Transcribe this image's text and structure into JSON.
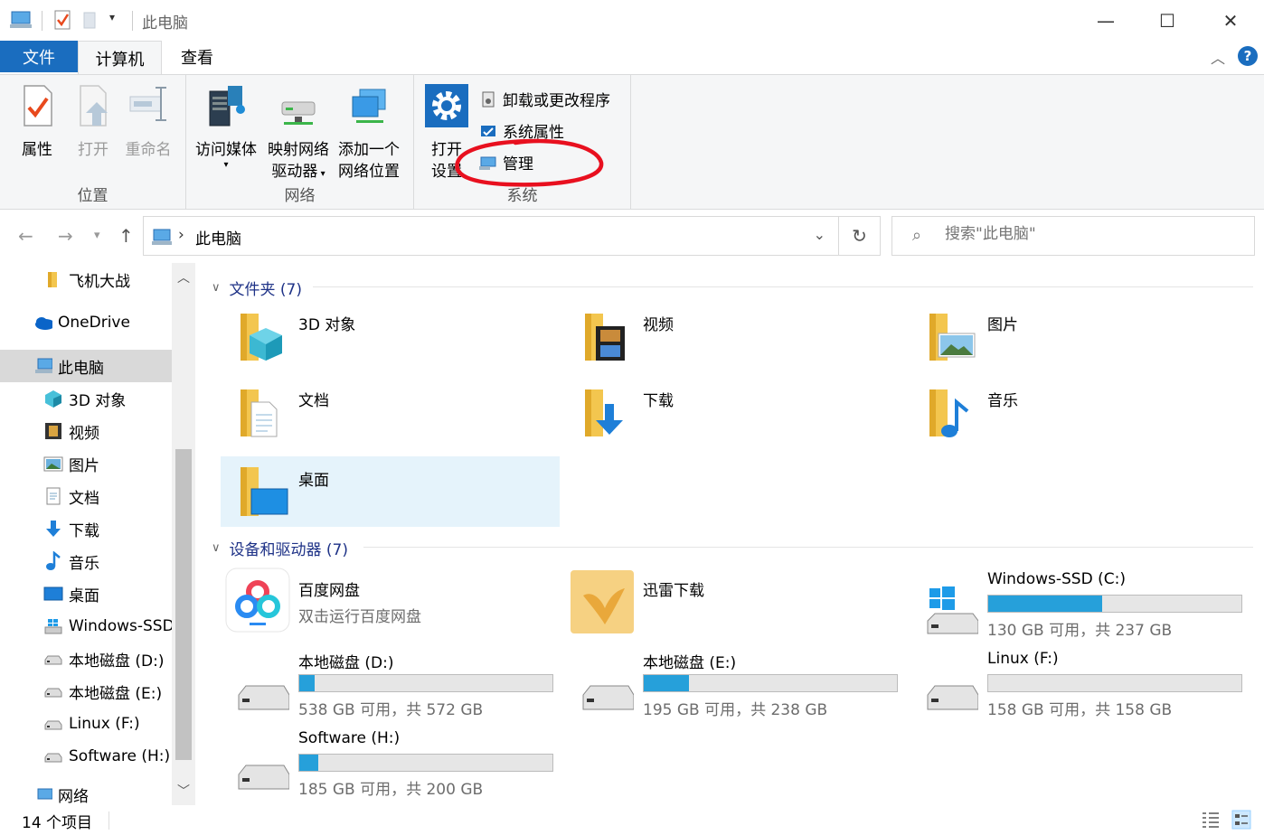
{
  "window": {
    "title": "此电脑",
    "minimize": "—",
    "maximize": "☐",
    "close": "✕"
  },
  "ribbon_tabs": {
    "file": "文件",
    "computer": "计算机",
    "view": "查看",
    "help": "?"
  },
  "ribbon": {
    "location": {
      "label": "位置",
      "properties": "属性",
      "open": "打开",
      "rename": "重命名"
    },
    "network": {
      "label": "网络",
      "access_media": "访问媒体",
      "map_drive_1": "映射网络",
      "map_drive_2": "驱动器",
      "add_location_1": "添加一个",
      "add_location_2": "网络位置"
    },
    "system": {
      "label": "系统",
      "open_settings_1": "打开",
      "open_settings_2": "设置",
      "uninstall": "卸载或更改程序",
      "system_properties": "系统属性",
      "manage": "管理"
    }
  },
  "address": {
    "path": "此电脑",
    "search_placeholder": "搜索\"此电脑\""
  },
  "sidebar": {
    "items": [
      {
        "label": "飞机大战",
        "icon": "folder-icon"
      },
      {
        "label": "OneDrive",
        "icon": "onedrive-icon"
      },
      {
        "label": "此电脑",
        "icon": "this-pc-icon"
      },
      {
        "label": "3D 对象",
        "icon": "3d-objects-icon"
      },
      {
        "label": "视频",
        "icon": "video-icon"
      },
      {
        "label": "图片",
        "icon": "pictures-icon"
      },
      {
        "label": "文档",
        "icon": "documents-icon"
      },
      {
        "label": "下载",
        "icon": "downloads-icon"
      },
      {
        "label": "音乐",
        "icon": "music-icon"
      },
      {
        "label": "桌面",
        "icon": "desktop-icon"
      },
      {
        "label": "Windows-SSD",
        "icon": "windows-drive-icon"
      },
      {
        "label": "本地磁盘 (D:)",
        "icon": "drive-icon"
      },
      {
        "label": "本地磁盘 (E:)",
        "icon": "drive-icon"
      },
      {
        "label": "Linux (F:)",
        "icon": "drive-icon"
      },
      {
        "label": "Software (H:)",
        "icon": "drive-icon"
      },
      {
        "label": "网络",
        "icon": "network-icon"
      }
    ]
  },
  "folders": {
    "header": "文件夹 (7)",
    "items": [
      {
        "name": "3D 对象"
      },
      {
        "name": "视频"
      },
      {
        "name": "图片"
      },
      {
        "name": "文档"
      },
      {
        "name": "下载"
      },
      {
        "name": "音乐"
      },
      {
        "name": "桌面"
      }
    ]
  },
  "devices": {
    "header": "设备和驱动器 (7)",
    "apps": [
      {
        "name": "百度网盘",
        "sub": "双击运行百度网盘"
      },
      {
        "name": "迅雷下载",
        "sub": ""
      }
    ],
    "drives": [
      {
        "name": "Windows-SSD (C:)",
        "free": "130 GB 可用，共 237 GB",
        "used_fraction": 0.45
      },
      {
        "name": "本地磁盘 (D:)",
        "free": "538 GB 可用，共 572 GB",
        "used_fraction": 0.06
      },
      {
        "name": "本地磁盘 (E:)",
        "free": "195 GB 可用，共 238 GB",
        "used_fraction": 0.18
      },
      {
        "name": "Linux (F:)",
        "free": "158 GB 可用，共 158 GB",
        "used_fraction": 0.0
      },
      {
        "name": "Software (H:)",
        "free": "185 GB 可用，共 200 GB",
        "used_fraction": 0.075
      }
    ]
  },
  "status": {
    "count": "14 个项目"
  },
  "colors": {
    "accent": "#1a6dbf",
    "drive_fill": "#26a0da",
    "annotation": "#e8101f"
  }
}
